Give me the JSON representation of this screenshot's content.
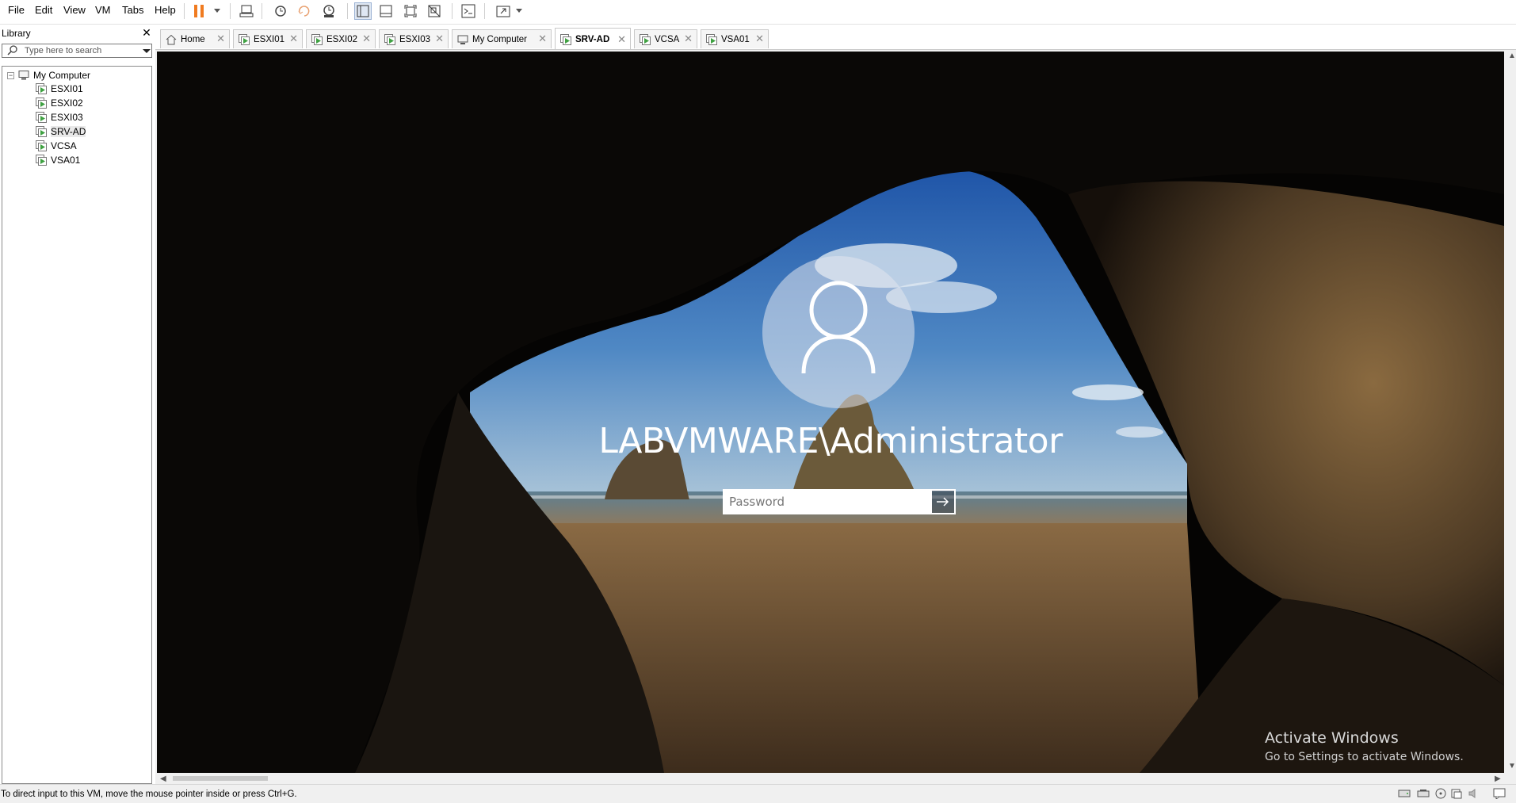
{
  "menu": {
    "items": [
      "File",
      "Edit",
      "View",
      "VM",
      "Tabs",
      "Help"
    ]
  },
  "toolbar": {
    "icons": [
      "pause-icon",
      "send-ctrl-alt-del-icon",
      "snapshot-take-icon",
      "snapshot-revert-icon",
      "snapshot-manager-icon",
      "show-library-icon",
      "show-thumbnail-bar-icon",
      "full-screen-icon",
      "unity-icon",
      "console-view-icon",
      "stretch-guest-icon"
    ]
  },
  "library": {
    "title": "Library",
    "close": "✕",
    "search_placeholder": "Type here to search",
    "root": "My Computer",
    "root_toggle": "−",
    "vms": [
      "ESXI01",
      "ESXI02",
      "ESXI03",
      "SRV-AD",
      "VCSA",
      "VSA01"
    ],
    "selected_vm": "SRV-AD"
  },
  "tabs": {
    "items": [
      {
        "label": "Home",
        "icon": "home-icon"
      },
      {
        "label": "ESXI01",
        "icon": "vm-icon"
      },
      {
        "label": "ESXI02",
        "icon": "vm-icon"
      },
      {
        "label": "ESXI03",
        "icon": "vm-icon"
      },
      {
        "label": "My Computer",
        "icon": "computer-icon"
      },
      {
        "label": "SRV-AD",
        "icon": "vm-icon"
      },
      {
        "label": "VCSA",
        "icon": "vm-icon"
      },
      {
        "label": "VSA01",
        "icon": "vm-icon"
      }
    ],
    "active": "SRV-AD",
    "close": "✕"
  },
  "vm_screen": {
    "username": "LABVMWARE\\Administrator",
    "password_placeholder": "Password",
    "password_value": "",
    "activate_title": "Activate Windows",
    "activate_subtitle": "Go to Settings to activate Windows."
  },
  "status": {
    "text": "To direct input to this VM, move the mouse pointer inside or press Ctrl+G.",
    "icons": [
      "hard-disk-icon",
      "network-adapter-icon",
      "cd-dvd-icon",
      "usb-icon",
      "sound-icon",
      "message-icon"
    ]
  },
  "colors": {
    "pause_orange": "#f07b20",
    "vm_green": "#3fa142",
    "login_text": "#ffffff"
  }
}
